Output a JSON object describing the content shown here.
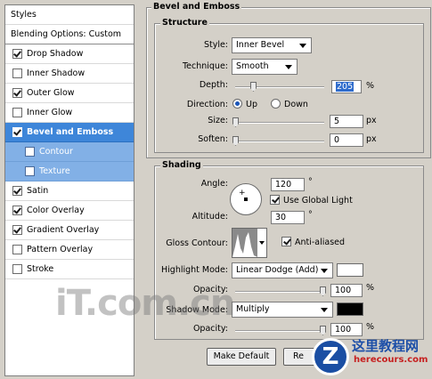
{
  "left_panel": {
    "styles_title": "Styles",
    "blending_options": "Blending Options: Custom",
    "items": [
      {
        "label": "Drop Shadow",
        "checked": true
      },
      {
        "label": "Inner Shadow",
        "checked": false
      },
      {
        "label": "Outer Glow",
        "checked": true
      },
      {
        "label": "Inner Glow",
        "checked": false
      },
      {
        "label": "Bevel and Emboss",
        "checked": true,
        "selected": true
      },
      {
        "label": "Contour",
        "checked": false,
        "sub": true
      },
      {
        "label": "Texture",
        "checked": false,
        "sub": true
      },
      {
        "label": "Satin",
        "checked": true
      },
      {
        "label": "Color Overlay",
        "checked": true
      },
      {
        "label": "Gradient Overlay",
        "checked": true
      },
      {
        "label": "Pattern Overlay",
        "checked": false
      },
      {
        "label": "Stroke",
        "checked": false
      }
    ]
  },
  "bevel": {
    "title": "Bevel and Emboss",
    "structure_title": "Structure",
    "style_label": "Style:",
    "style_value": "Inner Bevel",
    "technique_label": "Technique:",
    "technique_value": "Smooth",
    "depth_label": "Depth:",
    "depth_value": "205",
    "depth_unit": "%",
    "direction_label": "Direction:",
    "direction_up": "Up",
    "direction_down": "Down",
    "size_label": "Size:",
    "size_value": "5",
    "size_unit": "px",
    "soften_label": "Soften:",
    "soften_value": "0",
    "soften_unit": "px"
  },
  "shading": {
    "title": "Shading",
    "angle_label": "Angle:",
    "angle_value": "120",
    "angle_unit": "°",
    "use_global_light": "Use Global Light",
    "altitude_label": "Altitude:",
    "altitude_value": "30",
    "altitude_unit": "°",
    "gloss_contour_label": "Gloss Contour:",
    "anti_aliased": "Anti-aliased",
    "highlight_mode_label": "Highlight Mode:",
    "highlight_mode_value": "Linear Dodge (Add)",
    "highlight_color": "#ffffff",
    "opacity_label": "Opacity:",
    "highlight_opacity": "100",
    "opacity_unit": "%",
    "shadow_mode_label": "Shadow Mode:",
    "shadow_mode_value": "Multiply",
    "shadow_color": "#000000",
    "shadow_opacity": "100"
  },
  "buttons": {
    "make_default": "Make Default",
    "reset_partial": "Re"
  },
  "watermarks": {
    "logo": "iT.com.cn",
    "site_cn": "这里教程网",
    "site_url": "herecours.com",
    "badge": "Z"
  }
}
